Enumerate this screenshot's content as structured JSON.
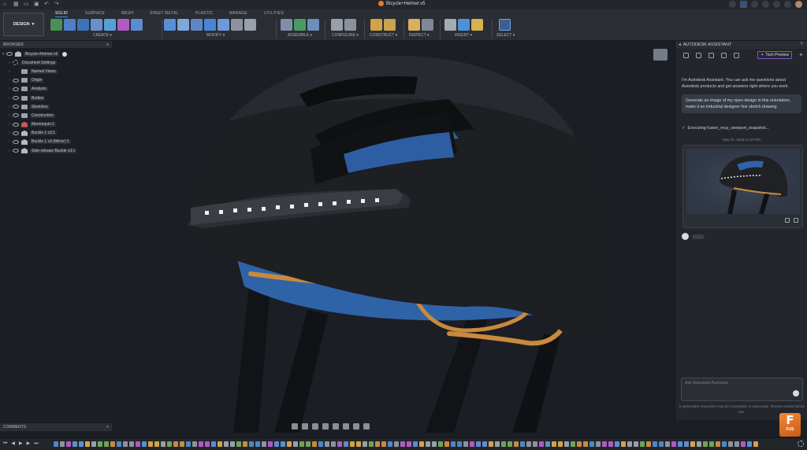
{
  "title_bar": {
    "document_title": "Bicycle+Helmet v5"
  },
  "ribbon": {
    "workspace": "DESIGN",
    "tabs": [
      "SOLID",
      "SURFACE",
      "MESH",
      "SHEET METAL",
      "PLASTIC",
      "MANAGE",
      "UTILITIES"
    ],
    "active_tab": "SOLID",
    "groups": [
      "CREATE ▾",
      "MODIFY ▾",
      "ASSEMBLE ▾",
      "CONFIGURE ▾",
      "CONSTRUCT ▾",
      "INSPECT ▾",
      "INSERT ▾",
      "SELECT ▾"
    ]
  },
  "browser": {
    "header": "BROWSER",
    "items": [
      {
        "label": "Bicycle+Helmet v5",
        "icon": "component-icon"
      },
      {
        "label": "Document Settings",
        "icon": "gear-icon"
      },
      {
        "label": "Named Views",
        "icon": "folder-icon"
      },
      {
        "label": "Origin",
        "icon": "folder-icon"
      },
      {
        "label": "Analysis",
        "icon": "folder-icon"
      },
      {
        "label": "Bodies",
        "icon": "folder-icon"
      },
      {
        "label": "Sketches",
        "icon": "folder-icon"
      },
      {
        "label": "Construction",
        "icon": "folder-icon"
      },
      {
        "label": "Mannequin:1",
        "icon": "component-icon"
      },
      {
        "label": "Buckle 1 v3:1",
        "icon": "component-icon"
      },
      {
        "label": "Buckle 1 v3 (Mirror):1",
        "icon": "component-icon"
      },
      {
        "label": "Side-release Buckle v3:1",
        "icon": "component-icon"
      }
    ]
  },
  "comments": {
    "label": "COMMENTS"
  },
  "assistant": {
    "header": "AUTODESK ASSISTANT",
    "tech_preview": "Tech Preview",
    "intro": "I'm Autodesk Assistant. You can ask me questions about Autodesk products and get answers right where you work.",
    "user_prompt": "Generate an image of my open design in this orientation, make it an industrial designer line sketch drawing",
    "status": "Executing fusion_mcp_viewport_snapshot...",
    "timestamp": "May 28, 2026 12:26 PM",
    "input_placeholder": "Ask Autodesk Assistant",
    "disclaimer": "AI-generated responses may be incomplete or inaccurate. Review results before use."
  },
  "app_badge": {
    "letter": "F",
    "label": "FUS"
  },
  "colors": {
    "accent_blue": "#3d8ee6",
    "brand_orange": "#e87b2b",
    "tech_preview_purple": "#8a56c9",
    "helmet_shell": "#1d1f23",
    "strap_orange": "#c98a3d",
    "padding_blue": "#2f63a8"
  }
}
